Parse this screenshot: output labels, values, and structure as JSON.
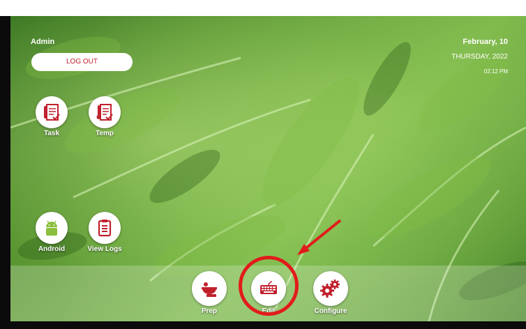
{
  "window": {
    "controls": "⧉ ✕"
  },
  "header": {
    "user": "Admin",
    "logout_label": "LOG OUT"
  },
  "datetime": {
    "line1": "February, 10",
    "line2": "THURSDAY, 2022",
    "time": "02:12 PM"
  },
  "apps": {
    "task": "Task",
    "temp": "Temp",
    "android": "Android",
    "view_logs": "View Logs"
  },
  "dock": {
    "prep": "Prep",
    "edit": "Edit",
    "configure": "Configure"
  },
  "colors": {
    "accent": "#c0202c",
    "annotation": "#e21b1b"
  }
}
